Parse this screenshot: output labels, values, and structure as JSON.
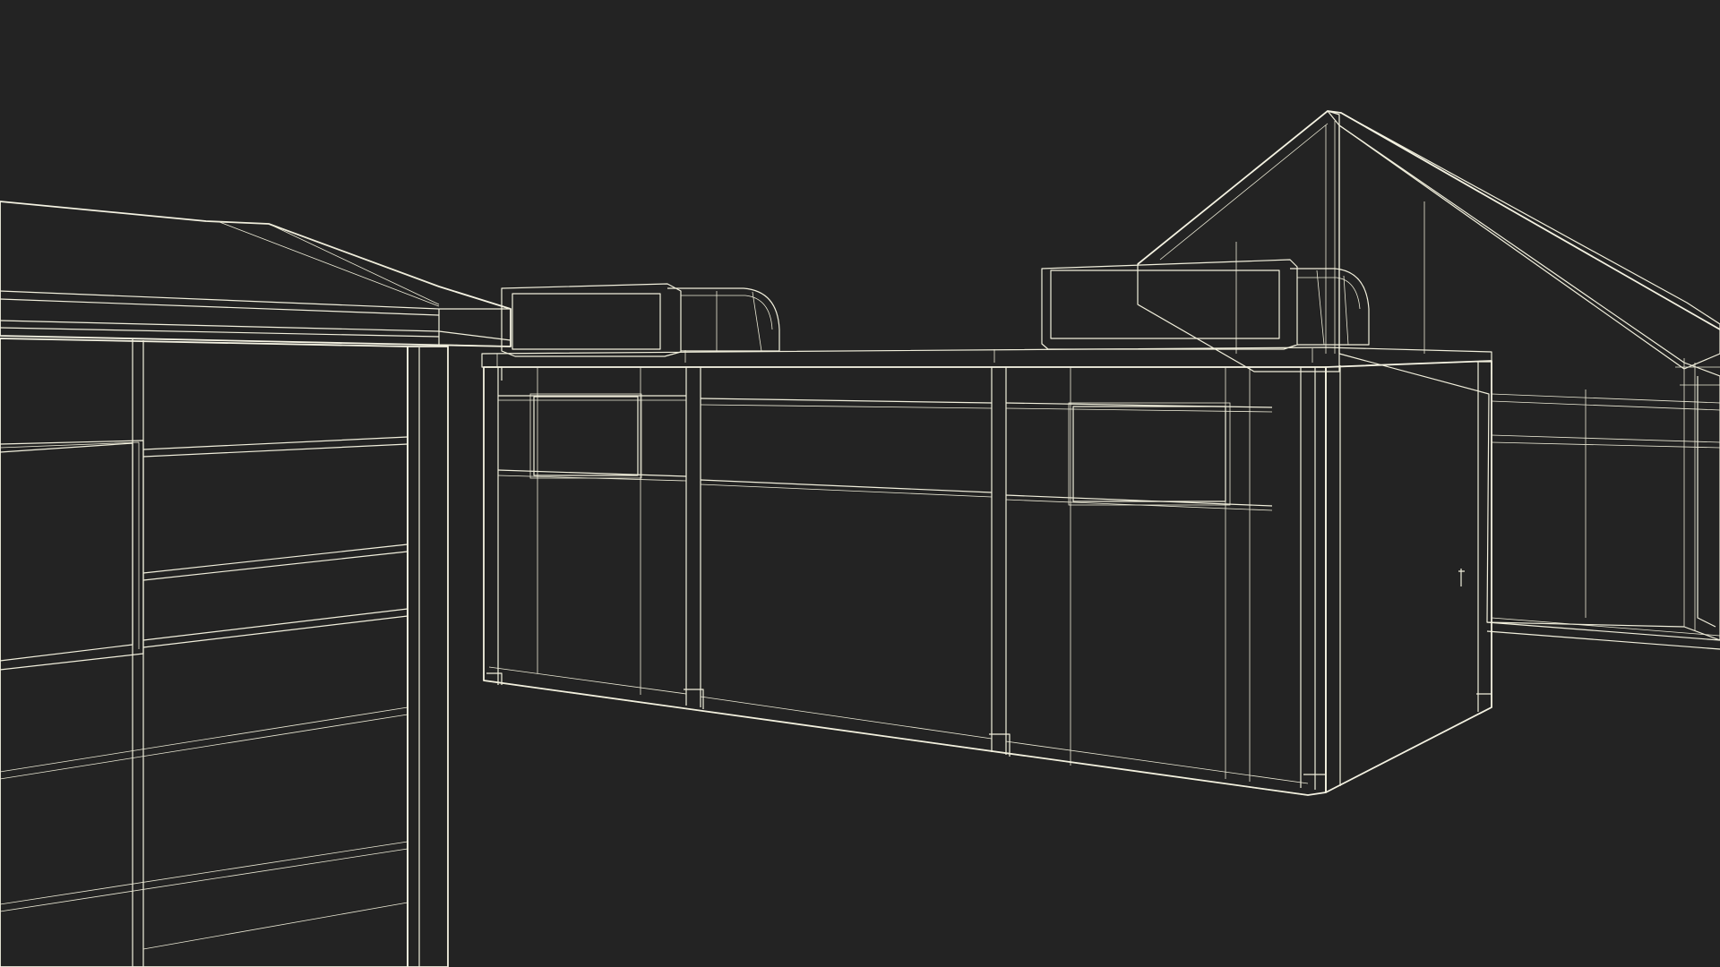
{
  "viewport": {
    "background_color": "#232323",
    "surface_color": "#797a6b",
    "surface_dark": "#6f7062",
    "surface_light": "#858676",
    "wireframe_color": "#f1efdc"
  },
  "objects": [
    {
      "name": "left-shed",
      "description_icon": "shed-icon"
    },
    {
      "name": "generator-enclosure",
      "description_icon": "container-icon"
    },
    {
      "name": "gable-house",
      "description_icon": "house-icon"
    }
  ]
}
